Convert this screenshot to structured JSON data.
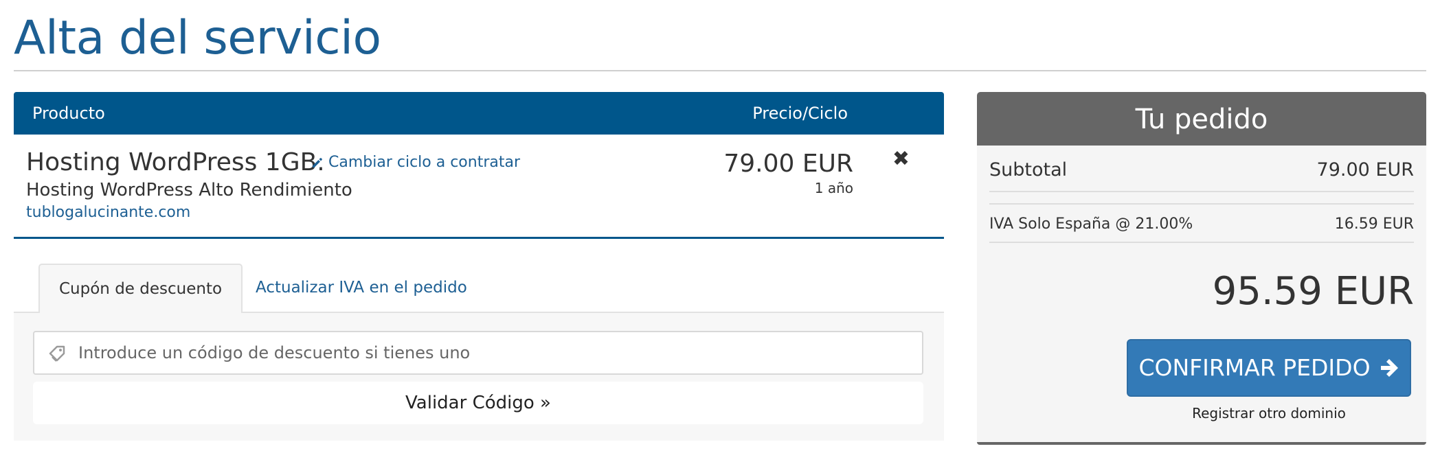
{
  "page": {
    "title": "Alta del servicio"
  },
  "table": {
    "header": {
      "product": "Producto",
      "price_cycle": "Precio/Ciclo"
    },
    "items": [
      {
        "name": "Hosting WordPress 1GB.",
        "change_cycle_label": "Cambiar ciclo a contratar",
        "description": "Hosting WordPress Alto Rendimiento",
        "domain": "tublogalucinante.com",
        "price": "79.00 EUR",
        "cycle": "1 año",
        "remove_glyph": "✖"
      }
    ]
  },
  "tabs": [
    {
      "label": "Cupón de descuento",
      "active": true
    },
    {
      "label": "Actualizar IVA en el pedido",
      "active": false
    }
  ],
  "coupon": {
    "placeholder": "Introduce un código de descuento si tienes uno",
    "value": "",
    "validate_label": "Validar Código »"
  },
  "summary": {
    "title": "Tu pedido",
    "subtotal_label": "Subtotal",
    "subtotal_value": "79.00 EUR",
    "tax_label": "IVA Solo España @ 21.00%",
    "tax_value": "16.59 EUR",
    "total": "95.59 EUR",
    "confirm_label": "CONFIRMAR PEDIDO",
    "other_domain_label": "Registrar otro dominio"
  },
  "icons": {
    "pencil": "pencil-icon",
    "remove": "close-icon",
    "tag": "tag-icon",
    "arrow": "arrow-right-icon"
  },
  "colors": {
    "brand_blue": "#00568b",
    "link_blue": "#1d5f93",
    "button_blue": "#337ab7",
    "summary_gray": "#666666"
  }
}
